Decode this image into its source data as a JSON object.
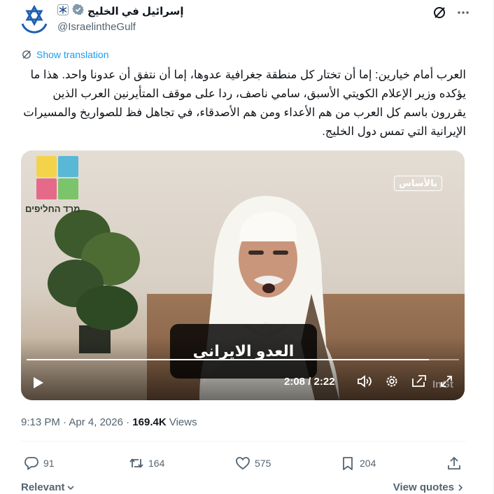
{
  "author": {
    "display_name": "إسرائيل في الخليج",
    "handle": "@IsraelintheGulf",
    "avatar_icon": "star-of-david-icon",
    "verified_icon": "verified-badge-icon",
    "affiliate_icon": "snowflake-emblem-icon"
  },
  "header_actions": {
    "grok_icon": "grok-icon",
    "more_icon": "more-icon"
  },
  "translation": {
    "label": "Show translation"
  },
  "tweet": {
    "text": "العرب أمام خيارين: إما أن تختار كل منطقة جغرافية عدوها، إما أن نتفق أن عدونا واحد. هذا ما يؤكده وزير الإعلام الكويتي الأسبق، سامي ناصف، ردا على موقف المتأيرنين العرب الذين يقررون باسم كل العرب من هم الأعداء ومن هم الأصدقاء، في تجاهل فظ للصواريخ والمسيرات الإيرانية التي تمس دول الخليج."
  },
  "video": {
    "channel_label": "מרד החליפים",
    "logo_text": "بالأساس",
    "caption": "العدو الايراني",
    "watermark": "InGt",
    "current_time": "2:08",
    "duration": "2:22",
    "progress": 0.93,
    "icons": [
      "play-icon",
      "volume-icon",
      "settings-icon",
      "pip-icon",
      "fullscreen-icon"
    ]
  },
  "meta": {
    "time": "9:13 PM",
    "date": "Apr 4, 2026",
    "views_count": "169.4K",
    "views_label": "Views"
  },
  "actions": {
    "replies": "91",
    "reposts": "164",
    "likes": "575",
    "bookmarks": "204"
  },
  "footer": {
    "sort_label": "Relevant",
    "view_quotes_label": "View quotes"
  },
  "colors": {
    "accent": "#1d9bf0",
    "muted": "#536471",
    "text": "#0f1419"
  }
}
